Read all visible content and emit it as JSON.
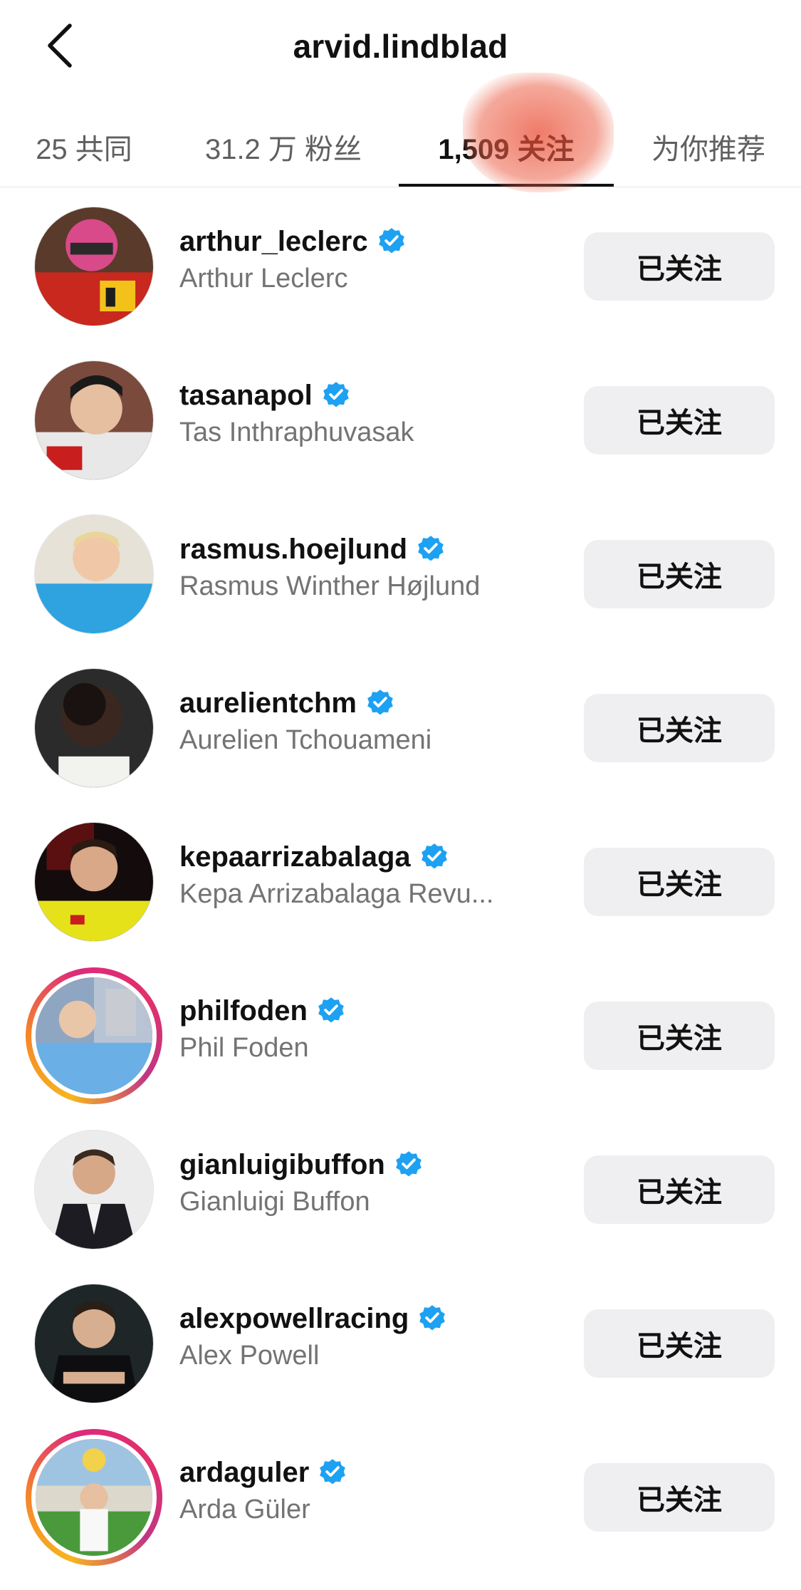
{
  "header": {
    "title": "arvid.lindblad"
  },
  "tabs": [
    {
      "label": "25 共同",
      "active": false
    },
    {
      "label": "31.2 万 粉丝",
      "active": false
    },
    {
      "label": "1,509 关注",
      "active": true
    },
    {
      "label": "为你推荐",
      "active": false
    }
  ],
  "colors": {
    "verified_badge": "#1da1f2",
    "button_bg": "#efeff1",
    "secondary_text": "#737373",
    "story_ring": [
      "#f7b51f",
      "#f58529",
      "#dd2a7b",
      "#c13584"
    ]
  },
  "accounts": [
    {
      "username": "arthur_leclerc",
      "full_name": "Arthur Leclerc",
      "verified": true,
      "story_ring": false,
      "button_label": "已关注"
    },
    {
      "username": "tasanapol",
      "full_name": "Tas Inthraphuvasak",
      "verified": true,
      "story_ring": false,
      "button_label": "已关注"
    },
    {
      "username": "rasmus.hoejlund",
      "full_name": "Rasmus Winther Højlund",
      "verified": true,
      "story_ring": false,
      "button_label": "已关注"
    },
    {
      "username": "aurelientchm",
      "full_name": "Aurelien Tchouameni",
      "verified": true,
      "story_ring": false,
      "button_label": "已关注"
    },
    {
      "username": "kepaarrizabalaga",
      "full_name": "Kepa Arrizabalaga Revu...",
      "verified": true,
      "story_ring": false,
      "button_label": "已关注"
    },
    {
      "username": "philfoden",
      "full_name": "Phil Foden",
      "verified": true,
      "story_ring": true,
      "button_label": "已关注"
    },
    {
      "username": "gianluigibuffon",
      "full_name": "Gianluigi Buffon",
      "verified": true,
      "story_ring": false,
      "button_label": "已关注"
    },
    {
      "username": "alexpowellracing",
      "full_name": "Alex Powell",
      "verified": true,
      "story_ring": false,
      "button_label": "已关注"
    },
    {
      "username": "ardaguler",
      "full_name": "Arda Güler",
      "verified": true,
      "story_ring": true,
      "button_label": "已关注"
    }
  ]
}
